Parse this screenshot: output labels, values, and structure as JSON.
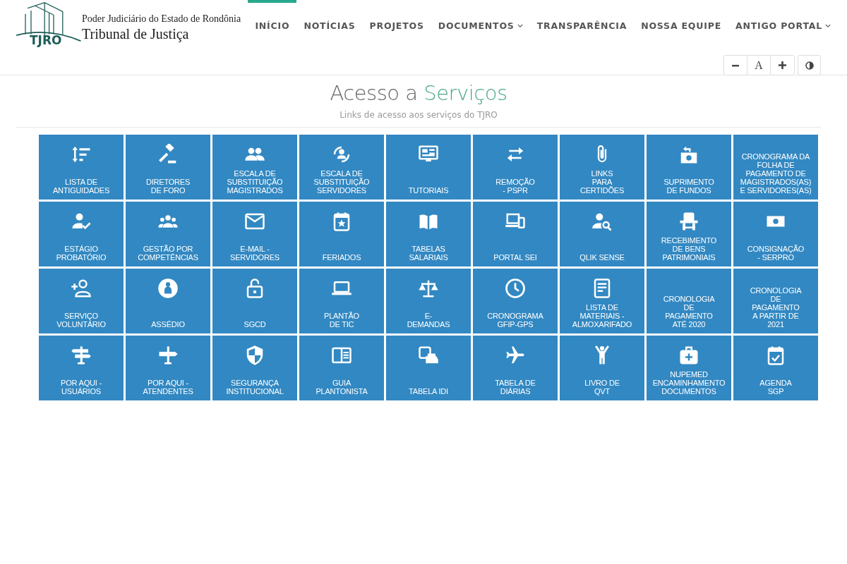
{
  "header": {
    "logo": {
      "mark": "TJRO",
      "subtitle": "Poder Judiciário do Estado de Rondônia",
      "title": "Tribunal de Justiça"
    },
    "nav": [
      {
        "label": "INÍCIO",
        "selected": true,
        "dropdown": false
      },
      {
        "label": "NOTÍCIAS",
        "selected": false,
        "dropdown": false
      },
      {
        "label": "PROJETOS",
        "selected": false,
        "dropdown": false
      },
      {
        "label": "DOCUMENTOS",
        "selected": false,
        "dropdown": true
      },
      {
        "label": "TRANSPARÊNCIA",
        "selected": false,
        "dropdown": false
      },
      {
        "label": "NOSSA EQUIPE",
        "selected": false,
        "dropdown": false
      },
      {
        "label": "ANTIGO PORTAL",
        "selected": false,
        "dropdown": true
      }
    ],
    "font_reset_label": "A"
  },
  "section": {
    "title_lead": "Acesso a",
    "title_accent": "Serviços",
    "subtitle": "Links de acesso aos serviços do TJRO"
  },
  "tiles": [
    {
      "lines": [
        "LISTA DE",
        "ANTIGUIDADES"
      ]
    },
    {
      "lines": [
        "DIRETORES",
        "DE FORO"
      ]
    },
    {
      "lines": [
        "ESCALA DE",
        "SUBSTITUIÇÃO",
        "MAGISTRADOS"
      ]
    },
    {
      "lines": [
        "ESCALA DE",
        "SUBSTITUIÇÃO",
        "SERVIDORES"
      ]
    },
    {
      "lines": [
        "TUTORIAIS"
      ]
    },
    {
      "lines": [
        "REMOÇÃO",
        "- PSPR"
      ]
    },
    {
      "lines": [
        "LINKS",
        "PARA",
        "CERTIDÕES"
      ]
    },
    {
      "lines": [
        "SUPRIMENTO",
        "DE FUNDOS"
      ]
    },
    {
      "lines": [
        "CRONOGRAMA DA",
        "FOLHA DE",
        "PAGAMENTO DE",
        "MAGISTRADOS(AS)",
        "E SERVIDORES(AS)"
      ]
    },
    {
      "lines": [
        "ESTÁGIO",
        "PROBATÓRIO"
      ]
    },
    {
      "lines": [
        "GESTÃO POR",
        "COMPETÊNCIAS"
      ]
    },
    {
      "lines": [
        "E-MAIL -",
        "SERVIDORES"
      ]
    },
    {
      "lines": [
        "FERIADOS"
      ]
    },
    {
      "lines": [
        "TABELAS",
        "SALARIAIS"
      ]
    },
    {
      "lines": [
        "PORTAL SEI"
      ]
    },
    {
      "lines": [
        "QLIK SENSE"
      ]
    },
    {
      "lines": [
        "RECEBIMENTO",
        "DE BENS",
        "PATRIMONIAIS"
      ]
    },
    {
      "lines": [
        "CONSIGNAÇÃO",
        "- SERPRO"
      ]
    },
    {
      "lines": [
        "SERVIÇO",
        "VOLUNTÁRIO"
      ]
    },
    {
      "lines": [
        "ASSÉDIO"
      ]
    },
    {
      "lines": [
        "SGCD"
      ]
    },
    {
      "lines": [
        "PLANTÃO",
        "DE TIC"
      ]
    },
    {
      "lines": [
        "E-",
        "DEMANDAS"
      ]
    },
    {
      "lines": [
        "CRONOGRAMA",
        "GFIP-GPS"
      ]
    },
    {
      "lines": [
        "LISTA DE",
        "MATERIAIS -",
        "ALMOXARIFADO"
      ]
    },
    {
      "lines": [
        "CRONOLOGIA",
        "DE",
        "PAGAMENTO",
        "ATÉ 2020"
      ]
    },
    {
      "lines": [
        "CRONOLOGIA",
        "DE",
        "PAGAMENTO",
        "A PARTIR DE",
        "2021"
      ]
    },
    {
      "lines": [
        "POR AQUI -",
        "USUÁRIOS"
      ]
    },
    {
      "lines": [
        "POR AQUI -",
        "ATENDENTES"
      ]
    },
    {
      "lines": [
        "SEGURANÇA",
        "INSTITUCIONAL"
      ]
    },
    {
      "lines": [
        "GUIA",
        "PLANTONISTA"
      ]
    },
    {
      "lines": [
        "TABELA IDI"
      ]
    },
    {
      "lines": [
        "TABELA DE",
        "DIÁRIAS"
      ]
    },
    {
      "lines": [
        "LIVRO DE",
        "QVT"
      ]
    },
    {
      "lines": [
        "NUPEMED",
        "ENCAMINHAMENTO",
        "DOCUMENTOS"
      ]
    },
    {
      "lines": [
        "AGENDA",
        "SGP"
      ]
    }
  ]
}
